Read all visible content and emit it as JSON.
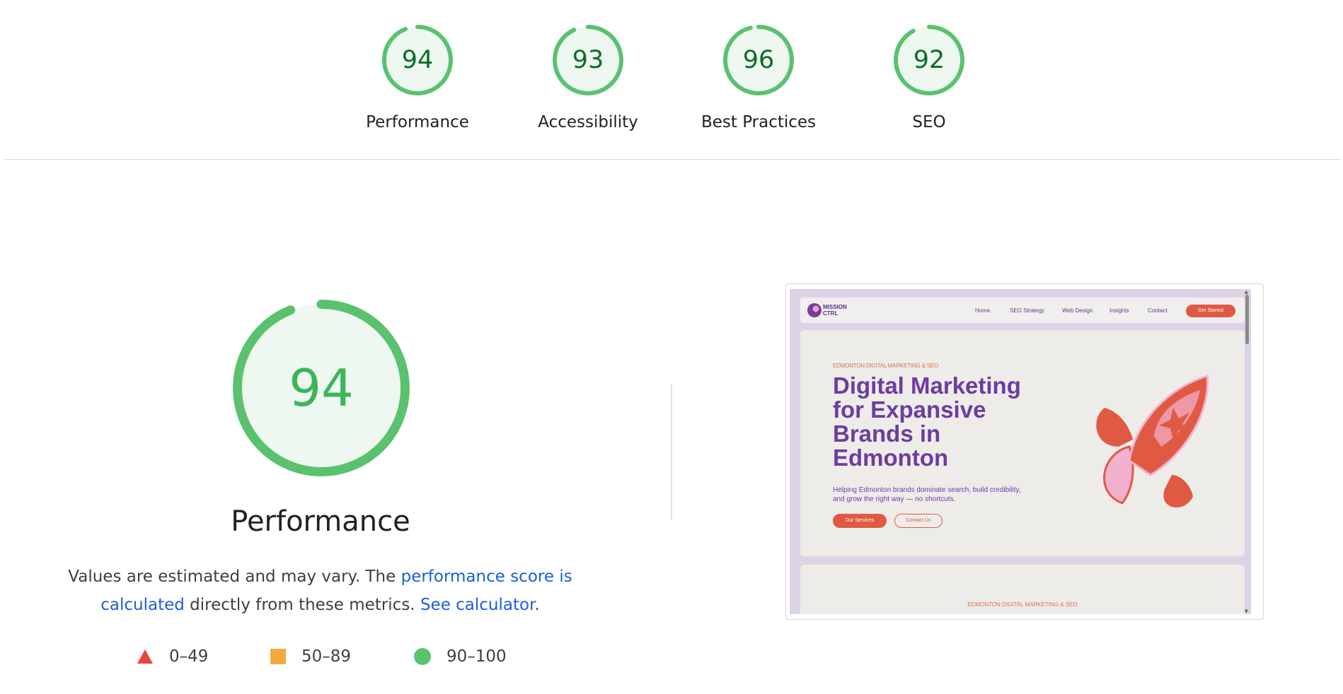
{
  "categories": [
    {
      "score": "94",
      "label": "Performance",
      "value": 0.94
    },
    {
      "score": "93",
      "label": "Accessibility",
      "value": 0.93
    },
    {
      "score": "96",
      "label": "Best Practices",
      "value": 0.96
    },
    {
      "score": "92",
      "label": "SEO",
      "value": 0.92
    }
  ],
  "main": {
    "score": "94",
    "value": 0.94,
    "title": "Performance",
    "desc_prefix": "Values are estimated and may vary. The ",
    "link_score": "performance score is calculated",
    "desc_mid": " directly from these metrics. ",
    "link_calculator": "See calculator",
    "desc_suffix": "."
  },
  "legend": [
    {
      "range": "0–49",
      "shape": "triangle",
      "color": "#e8453c"
    },
    {
      "range": "50–89",
      "shape": "square",
      "color": "#f4a93e"
    },
    {
      "range": "90–100",
      "shape": "circle",
      "color": "#5ac26e"
    }
  ],
  "colors": {
    "pass_ring": "#5ac26e",
    "pass_fill": "#eef8f0",
    "pass_text": "#0b6e24"
  },
  "preview": {
    "logo_line1": "MISSION",
    "logo_line2": "CTRL",
    "nav": [
      "Home",
      "SEO Strategy",
      "Web Design",
      "Insights",
      "Contact"
    ],
    "cta": "Get Started",
    "eyebrow": "EDMONTON DIGITAL MARKETING & SEO",
    "title": "Digital Marketing for Expansive Brands in Edmonton",
    "subtitle": "Helping Edmonton brands dominate search, build credibility, and grow the right way — no shortcuts.",
    "btn_primary": "Our Services",
    "btn_secondary": "Contact Us",
    "eyebrow2": "EDMONTON DIGITAL MARKETING & SEO"
  }
}
